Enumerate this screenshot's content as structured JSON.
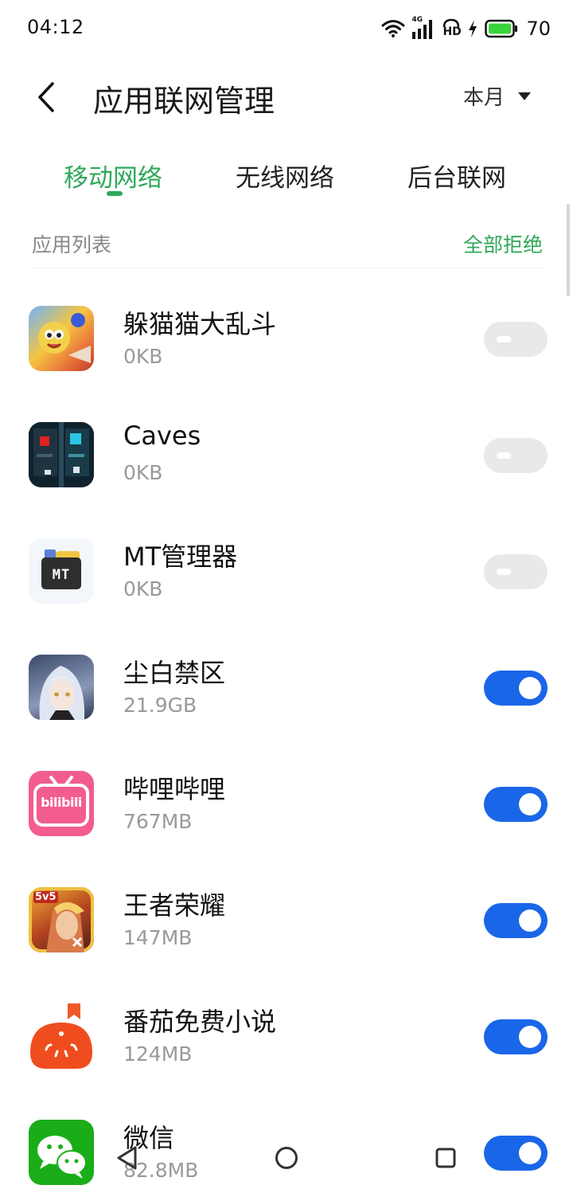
{
  "status_bar": {
    "time": "04:12",
    "battery": "70",
    "network_label": "4G",
    "hd_label": "HD"
  },
  "header": {
    "title": "应用联网管理",
    "period": "本月"
  },
  "tabs": [
    {
      "label": "移动网络",
      "active": true
    },
    {
      "label": "无线网络",
      "active": false
    },
    {
      "label": "后台联网",
      "active": false
    }
  ],
  "list_header": {
    "title": "应用列表",
    "deny_all": "全部拒绝"
  },
  "apps": [
    {
      "name": "躲猫猫大乱斗",
      "usage": "0KB",
      "enabled": false,
      "icon": "hide-and-seek-game-icon"
    },
    {
      "name": "Caves",
      "usage": "0KB",
      "enabled": false,
      "icon": "caves-game-icon"
    },
    {
      "name": "MT管理器",
      "usage": "0KB",
      "enabled": false,
      "icon": "mt-manager-icon",
      "icon_text": "MT"
    },
    {
      "name": "尘白禁区",
      "usage": "21.9GB",
      "enabled": true,
      "icon": "snowbreak-game-icon"
    },
    {
      "name": "哔哩哔哩",
      "usage": "767MB",
      "enabled": true,
      "icon": "bilibili-icon",
      "icon_text": "bilibili"
    },
    {
      "name": "王者荣耀",
      "usage": "147MB",
      "enabled": true,
      "icon": "honor-of-kings-icon",
      "icon_text": "5v5"
    },
    {
      "name": "番茄免费小说",
      "usage": "124MB",
      "enabled": true,
      "icon": "tomato-novel-icon"
    },
    {
      "name": "微信",
      "usage": "82.8MB",
      "enabled": true,
      "icon": "wechat-icon"
    }
  ],
  "colors": {
    "accent_green": "#2fa85a",
    "toggle_on": "#1a66e8",
    "toggle_off": "#e9e9e9"
  }
}
